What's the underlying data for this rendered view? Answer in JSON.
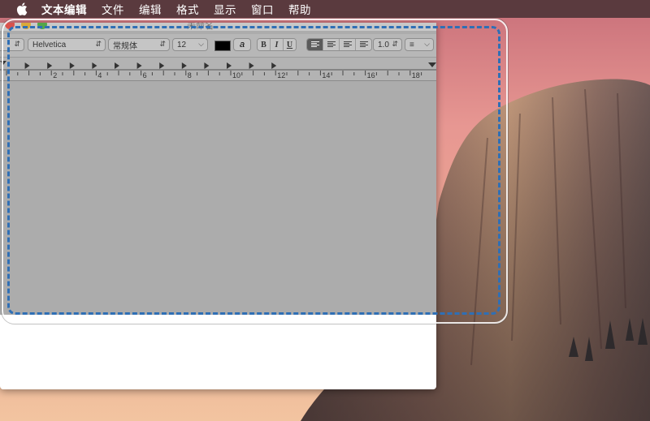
{
  "menubar": {
    "apple_icon": "apple-icon",
    "items": [
      {
        "label": "文本编辑"
      },
      {
        "label": "文件"
      },
      {
        "label": "编辑"
      },
      {
        "label": "格式"
      },
      {
        "label": "显示"
      },
      {
        "label": "窗口"
      },
      {
        "label": "帮助"
      }
    ]
  },
  "window": {
    "title": "未命名"
  },
  "toolbar": {
    "font_family": "Helvetica",
    "font_style": "常规体",
    "font_size": "12",
    "text_color": "#000000",
    "strike_label": "a",
    "bold_label": "B",
    "italic_label": "I",
    "underline_label": "U",
    "line_spacing": "1.0",
    "list_icon": "list-icon"
  },
  "ruler": {
    "labels": [
      "2",
      "4",
      "6",
      "8",
      "10",
      "12",
      "14",
      "16",
      "18"
    ]
  },
  "colors": {
    "menubar_bg": "#5a3a3e",
    "window_gray": "#acacac",
    "selection_blue": "#2f6fb5"
  }
}
